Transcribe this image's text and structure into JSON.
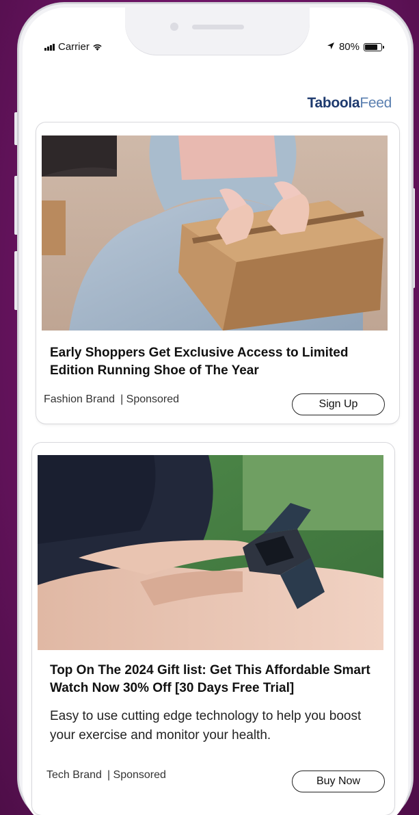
{
  "status_bar": {
    "carrier": "Carrier",
    "battery": "80%",
    "battery_level": 0.8
  },
  "header": {
    "logo_bold": "Taboola",
    "logo_light": "Feed"
  },
  "cards": [
    {
      "headline": "Early Shoppers Get Exclusive Access to Limited Edition Running Shoe of The Year",
      "brand": "Fashion Brand",
      "sponsored": "| Sponsored",
      "cta": "Sign Up",
      "image": "hands-taping-cardboard-box"
    },
    {
      "headline": "Top On The 2024 Gift list: Get This Affordable Smart Watch Now 30% Off [30 Days Free Trial]",
      "description": "Easy to use cutting edge technology to help you boost your exercise and monitor your health.",
      "brand": "Tech Brand",
      "sponsored": "| Sponsored",
      "cta": "Buy Now",
      "image": "finger-tapping-smart-watch"
    }
  ],
  "colors": {
    "background": "#6a1462",
    "logo_dark": "#1e3a6e",
    "logo_light": "#5a7fb0"
  }
}
